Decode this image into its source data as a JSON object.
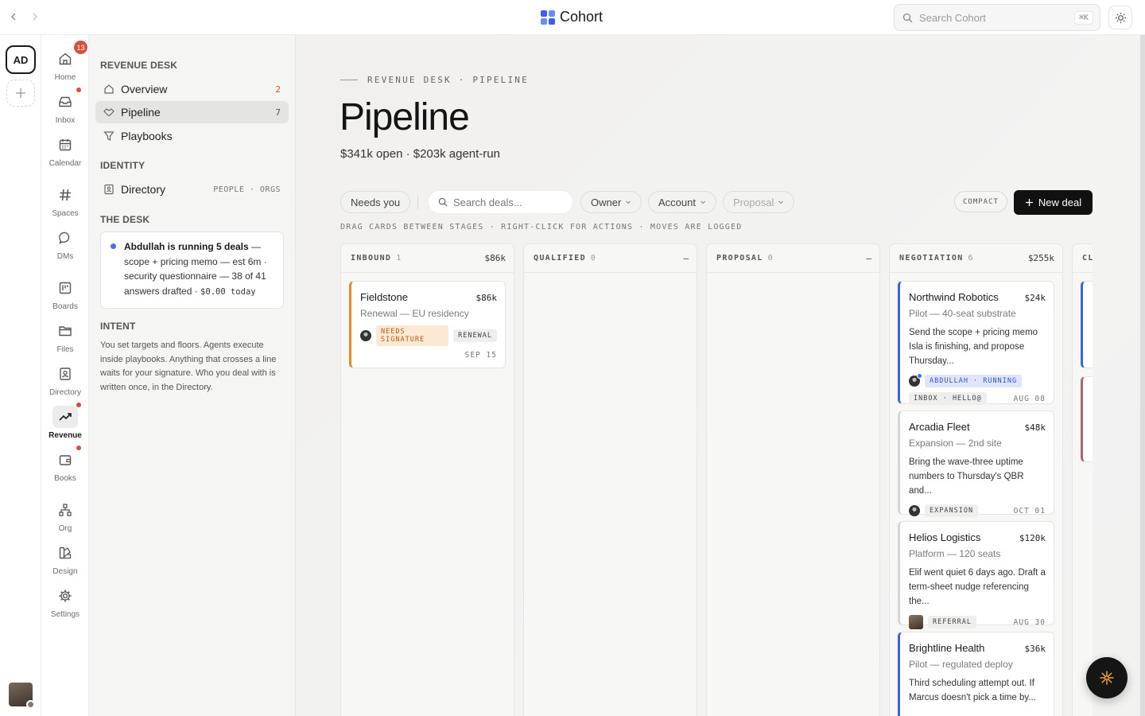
{
  "app": {
    "name": "Cohort",
    "search_placeholder": "Search Cohort",
    "search_shortcut": "⌘K"
  },
  "workspace": {
    "initials": "AD"
  },
  "apps": [
    {
      "label": "Home",
      "icon": "home-icon",
      "badge": "13"
    },
    {
      "label": "Inbox",
      "icon": "inbox-icon",
      "dot": true
    },
    {
      "label": "Calendar",
      "icon": "calendar-icon"
    },
    {
      "label": "Spaces",
      "icon": "hash-icon"
    },
    {
      "label": "DMs",
      "icon": "chat-bubble-icon"
    },
    {
      "label": "Boards",
      "icon": "board-icon"
    },
    {
      "label": "Files",
      "icon": "folder-icon"
    },
    {
      "label": "Directory",
      "icon": "contact-card-icon"
    },
    {
      "label": "Revenue",
      "icon": "trending-up-icon",
      "dot": true,
      "active": true
    },
    {
      "label": "Books",
      "icon": "wallet-icon",
      "dot": true
    },
    {
      "label": "Org",
      "icon": "org-chart-icon"
    },
    {
      "label": "Design",
      "icon": "design-icon"
    },
    {
      "label": "Settings",
      "icon": "gear-icon"
    }
  ],
  "sidebar": {
    "section1": "REVENUE DESK",
    "items": [
      {
        "label": "Overview",
        "count": "2"
      },
      {
        "label": "Pipeline",
        "count": "7"
      },
      {
        "label": "Playbooks"
      }
    ],
    "section2": "IDENTITY",
    "directory": {
      "label": "Directory",
      "meta": "PEOPLE · ORGS"
    },
    "section3": "THE DESK",
    "desk": {
      "agent": "Abdullah is running 5 deals",
      "text": " — scope + pricing memo — est 6m · security questionnaire — 38 of 41 answers drafted · ",
      "cost": "$0.00 today"
    },
    "section4": "INTENT",
    "intent": "You set targets and floors. Agents execute inside playbooks. Anything that crosses a line waits for your signature. Who you deal with is written once, in the Directory."
  },
  "main": {
    "eyebrow": "REVENUE DESK · PIPELINE",
    "title": "Pipeline",
    "subtitle": "$341k open · $203k agent-run",
    "filters": {
      "needs_you": "Needs you",
      "search_placeholder": "Search deals...",
      "owner": "Owner",
      "account": "Account",
      "proposal": "Proposal",
      "compact": "COMPACT",
      "new_deal": "New deal"
    },
    "hint": "DRAG CARDS BETWEEN STAGES · RIGHT-CLICK FOR ACTIONS · MOVES ARE LOGGED"
  },
  "columns": [
    {
      "title": "INBOUND",
      "count": "1",
      "amount": "$86k"
    },
    {
      "title": "QUALIFIED",
      "count": "0",
      "amount": "—"
    },
    {
      "title": "PROPOSAL",
      "count": "0",
      "amount": "—"
    },
    {
      "title": "NEGOTIATION",
      "count": "6",
      "amount": "$255k"
    },
    {
      "title": "CL",
      "count": "",
      "amount": ""
    }
  ],
  "cards": {
    "fieldstone": {
      "name": "Fieldstone",
      "amount": "$86k",
      "sub": "Renewal — EU residency",
      "tag1": "NEEDS SIGNATURE",
      "tag2": "RENEWAL",
      "date": "SEP 15"
    },
    "northwind": {
      "name": "Northwind Robotics",
      "amount": "$24k",
      "sub": "Pilot — 40-seat substrate",
      "body": "Send the scope + pricing memo Isla is finishing, and propose Thursday...",
      "tag1": "ABDULLAH · RUNNING",
      "tag2": "INBOX · HELLO@",
      "date": "AUG 08"
    },
    "arcadia": {
      "name": "Arcadia Fleet",
      "amount": "$48k",
      "sub": "Expansion — 2nd site",
      "body": "Bring the wave-three uptime numbers to Thursday's QBR and...",
      "tag1": "EXPANSION",
      "date": "OCT 01"
    },
    "helios": {
      "name": "Helios Logistics",
      "amount": "$120k",
      "sub": "Platform — 120 seats",
      "body": "Elif went quiet 6 days ago. Draft a term-sheet nudge referencing the...",
      "tag1": "REFERRAL",
      "date": "AUG 30"
    },
    "brightline": {
      "name": "Brightline Health",
      "amount": "$36k",
      "sub": "Pilot — regulated deploy",
      "body": "Third scheduling attempt out. If Marcus doesn't pick a time by..."
    }
  },
  "colors": {
    "accent": "#4a6cf7",
    "alert": "#d4503b",
    "primary_button": "#111111",
    "inbound_stripe": "#e18a2a",
    "agent_stripe": "#3a62e8"
  }
}
